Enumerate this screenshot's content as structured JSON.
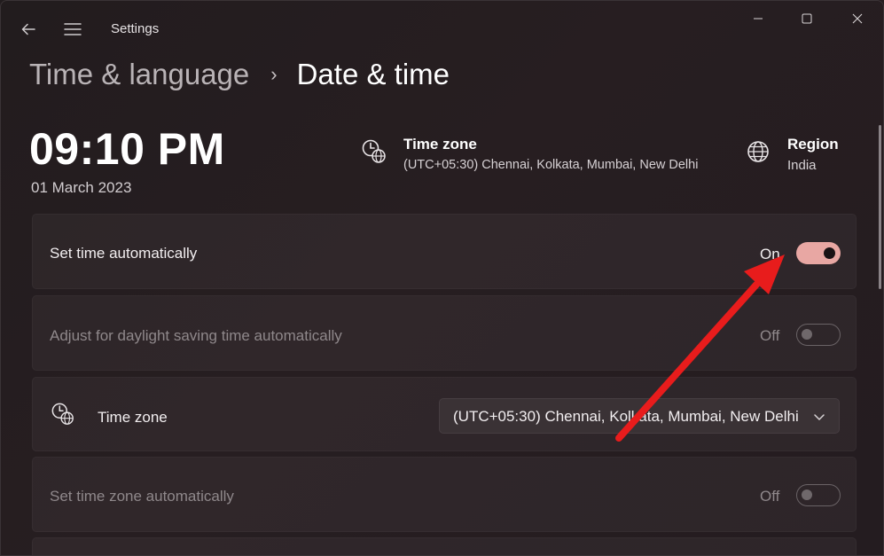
{
  "window": {
    "app_title": "Settings"
  },
  "breadcrumb": {
    "parent": "Time & language",
    "separator": "›",
    "current": "Date & time"
  },
  "summary": {
    "time": "09:10 PM",
    "date": "01 March 2023",
    "timezone_title": "Time zone",
    "timezone_value": "(UTC+05:30) Chennai, Kolkata, Mumbai, New Delhi",
    "region_title": "Region",
    "region_value": "India"
  },
  "settings": [
    {
      "label": "Set time automatically",
      "state_text": "On",
      "state": "on",
      "enabled": true
    },
    {
      "label": "Adjust for daylight saving time automatically",
      "state_text": "Off",
      "state": "off",
      "enabled": false
    },
    {
      "label": "Time zone",
      "dropdown_value": "(UTC+05:30) Chennai, Kolkata, Mumbai, New Delhi",
      "enabled": true
    },
    {
      "label": "Set time zone automatically",
      "state_text": "Off",
      "state": "off",
      "enabled": false
    }
  ],
  "colors": {
    "toggle_on": "#e8a7a3",
    "annotation_arrow": "#e81c1c",
    "background": "#231c1f"
  }
}
